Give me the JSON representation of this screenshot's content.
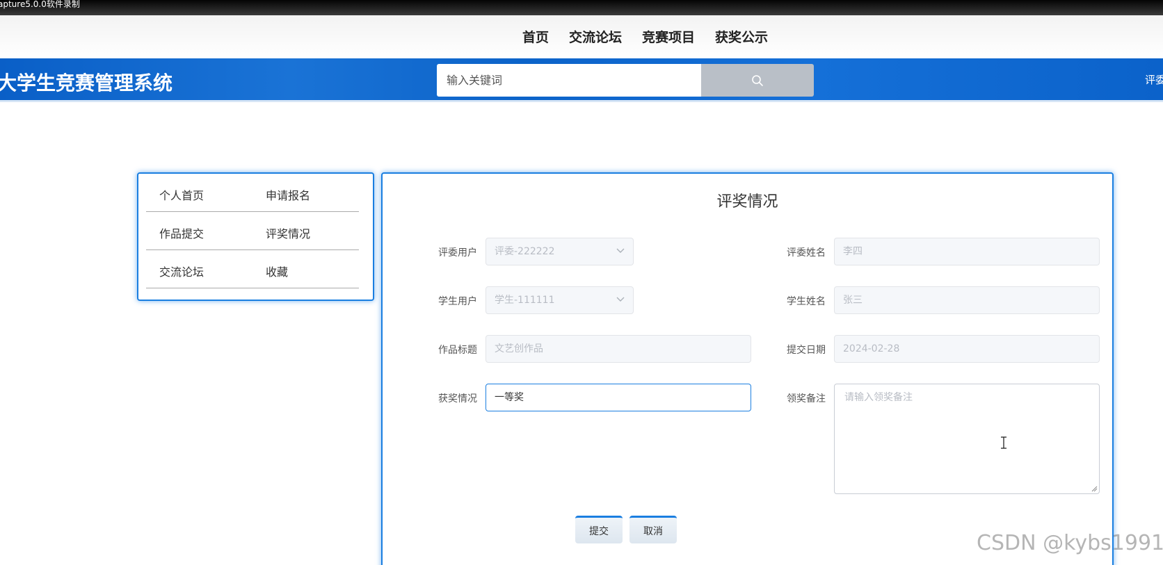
{
  "overlay": {
    "recorder_text": "apture5.0.0软件录制"
  },
  "top_nav": {
    "items": [
      "首页",
      "交流论坛",
      "竞赛项目",
      "获奖公示"
    ]
  },
  "header": {
    "site_title": "大学生竞赛管理系统",
    "search_placeholder": "输入关键词",
    "right_text": "评委"
  },
  "sidebar": {
    "rows": [
      [
        "个人首页",
        "申请报名"
      ],
      [
        "作品提交",
        "评奖情况"
      ],
      [
        "交流论坛",
        "收藏"
      ]
    ]
  },
  "form": {
    "title": "评奖情况",
    "fields": {
      "judge_user": {
        "label": "评委用户",
        "value": "评委-222222"
      },
      "judge_name": {
        "label": "评委姓名",
        "value": "李四"
      },
      "student_user": {
        "label": "学生用户",
        "value": "学生-111111"
      },
      "student_name": {
        "label": "学生姓名",
        "value": "张三"
      },
      "work_title": {
        "label": "作品标题",
        "value": "文艺创作品"
      },
      "submit_date": {
        "label": "提交日期",
        "value": "2024-02-28"
      },
      "award": {
        "label": "获奖情况",
        "value": "一等奖"
      },
      "award_note": {
        "label": "领奖备注",
        "placeholder": "请输入领奖备注"
      }
    },
    "submit_label": "提交",
    "cancel_label": "取消"
  },
  "watermark": "CSDN @kybs1991",
  "colors": {
    "header_blue": "#0c63c9",
    "accent": "#1a7ee0",
    "search_button": "#b9bfc7"
  }
}
